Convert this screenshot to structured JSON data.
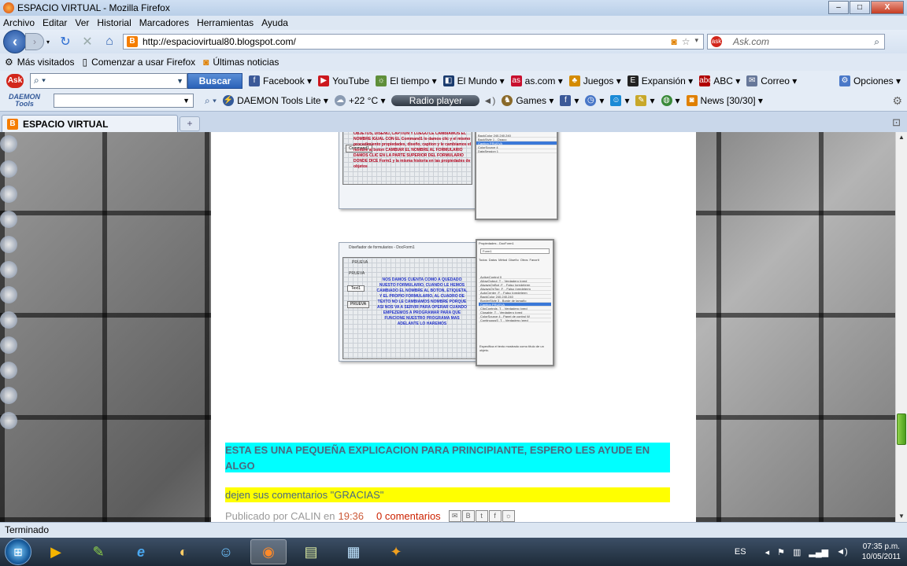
{
  "window": {
    "title": "ESPACIO VIRTUAL - Mozilla Firefox",
    "minimize": "–",
    "maximize": "□",
    "close": "X"
  },
  "menu": [
    "Archivo",
    "Editar",
    "Ver",
    "Historial",
    "Marcadores",
    "Herramientas",
    "Ayuda"
  ],
  "nav": {
    "url": "http://espaciovirtual80.blogspot.com/",
    "search_placeholder": "Ask.com",
    "search_engine": "ask"
  },
  "bookmarks": [
    {
      "icon": "gear-icon",
      "label": "Más visitados"
    },
    {
      "icon": "page-icon",
      "label": "Comenzar a usar Firefox"
    },
    {
      "icon": "rss-icon",
      "label": "Últimas noticias"
    }
  ],
  "ask_toolbar": {
    "badge": "Ask",
    "button": "Buscar",
    "items": [
      {
        "icon": "facebook-icon",
        "label": "Facebook",
        "color": "#3b5998"
      },
      {
        "icon": "youtube-icon",
        "label": "YouTube",
        "color": "#cc181e"
      },
      {
        "icon": "weather-icon",
        "label": "El tiempo",
        "color": "#5f8f3a"
      },
      {
        "icon": "newspaper-icon",
        "label": "El Mundo",
        "color": "#1a3b6e"
      },
      {
        "icon": "as-icon",
        "label": "as.com",
        "color": "#c8102e"
      },
      {
        "icon": "games-icon",
        "label": "Juegos",
        "color": "#d48b00"
      },
      {
        "icon": "expansion-icon",
        "label": "Expansión",
        "color": "#222222"
      },
      {
        "icon": "abc-icon",
        "label": "ABC",
        "color": "#b00000"
      },
      {
        "icon": "mail-icon",
        "label": "Correo",
        "color": "#667799"
      }
    ],
    "options": "Opciones"
  },
  "daemon_toolbar": {
    "logo_line1": "DAEMON",
    "logo_line2": "Tools",
    "product": "DAEMON Tools Lite",
    "temperature": "+22 °C",
    "radio": "Radio player",
    "games": "Games",
    "news": "News [30/30]"
  },
  "tab": {
    "title": "ESPACIO VIRTUAL",
    "new_tab": "+"
  },
  "post": {
    "screenshot1": {
      "button": "Command1",
      "red_text": "OBJETOS, DISEÑO, CAPTION Y LUEGO LE CAMBIAMOS EL NOMBRE IGUAL CON EL Command1 lo damos clic y el mismo procedimiento propiedades, diseño, caption y le cambiamos el nombre al boton CAMBIAR EL NOMBRE AL FORMULARIO DAMOS CLIC EN LA PARTE SUPERIOR DEL FORMULARIO DONDE DICE Form1 y la misma historia en las propiedades de objetos"
    },
    "screenshot2": {
      "window_title": "Diseñador de formularios - DocForm1",
      "form_title": "PRUEVA",
      "label": "PRUEVA",
      "textbox": "Text1",
      "button": "PRUEVA",
      "blue_text": "NOS DAMOS CUENTA COMO A QUEDADO NUESTO FORMULARIO, CUANDO LE HEMOS CAMBIADO EL NOMBRE AL BOTON, ETIQUETA, Y EL PROPIO FORMULARIO, AL CUADRO DE TEXTO NO LE CAMBIAMOS NOMBRE PORQUE ASI NOS VA A SERVIR PARA OPERAR CUANDO EMPEZEMOS A PROGRAMAR PARA QUE FUNCIONE NUESTRO PROGRAMA MAS ADELANTE LO HAREMOS",
      "props_title": "Propiedades - DocForm1",
      "props_object": "Form1",
      "props_tabs": [
        "Todos",
        "Datos",
        "Métod",
        "Diseño",
        "Otros",
        "Favorit"
      ],
      "props_rows": [
        "ActiveControl 0",
        "AllowOutput .T. - Verdadero (pred",
        "AlwaysOnBot .F. - Falso (predeterm",
        "AlwaysOnTop .F. - Falso (predeterm",
        "AutoCenter .F. - Falso (predeterm",
        "BackColor 240,240,240",
        "BorderStyle 3 - Borde de tamaño",
        "Caption PRUEVA",
        "ClipControls .T. - Verdadero (pred",
        "Closable .T. - Verdadero (pred",
        "ColorSource 4 - Panel de control W",
        "ContinuousS .T. - Verdadero (pred"
      ],
      "props_selected": 7,
      "props_desc": "Especifica el texto mostrado como título de un objeto."
    },
    "highlight": "ESTA ES UNA PEQUEÑA EXPLICACION PARA PRINCIPIANTE, ESPERO LES AYUDE EN ALGO",
    "comment_request": "dejen sus comentarios \"GRACIAS\"",
    "footer": {
      "published_by": "Publicado por CALIN en",
      "time": "19:36",
      "comments": "0 comentarios"
    }
  },
  "status": "Terminado",
  "taskbar": {
    "apps": [
      {
        "icon": "media-player-icon",
        "glyph": "▶"
      },
      {
        "icon": "paint-icon",
        "glyph": "✎"
      },
      {
        "icon": "internet-explorer-icon",
        "glyph": "e"
      },
      {
        "icon": "paint-palette-icon",
        "glyph": "◐"
      },
      {
        "icon": "messenger-icon",
        "glyph": "☺"
      },
      {
        "icon": "firefox-icon",
        "glyph": "◉",
        "active": true
      },
      {
        "icon": "folder-icon",
        "glyph": "▤"
      },
      {
        "icon": "notepad-icon",
        "glyph": "▦"
      },
      {
        "icon": "foxpro-icon",
        "glyph": "✦"
      }
    ],
    "language": "ES",
    "time": "07:35 p.m.",
    "date": "10/05/2011"
  }
}
